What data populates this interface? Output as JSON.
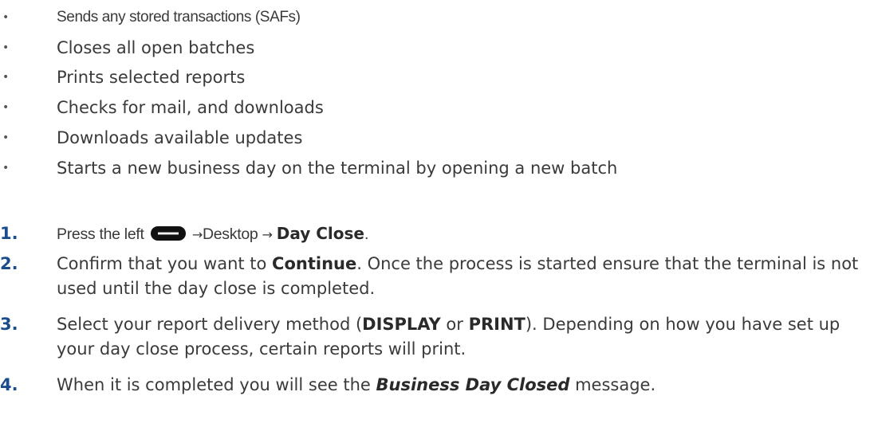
{
  "bullets": [
    {
      "text": "Sends any stored transactions (SAFs)"
    },
    {
      "text": "Closes all open batches"
    },
    {
      "text": "Prints selected reports"
    },
    {
      "text": "Checks for mail, and downloads"
    },
    {
      "text": "Downloads available updates"
    },
    {
      "text": "Starts a new business day on the terminal by opening a new batch"
    }
  ],
  "bullet_marker": "•",
  "arrow": "→",
  "steps": [
    {
      "number": "1.",
      "text_press_left": "Press the left",
      "text_desktop": "Desktop",
      "bold_day_close": "Day Close",
      "end": ".",
      "icon": "menu-key-icon"
    },
    {
      "number": "2.",
      "text_a": "Confirm that you want to ",
      "bold_continue": "Continue",
      "text_b": ". Once the process is started ensure that the terminal is not used until the day close is completed."
    },
    {
      "number": "3.",
      "text_a": "Select your report delivery method (",
      "bold_display": "DISPLAY",
      "text_or": " or ",
      "bold_print": "PRINT",
      "text_b": "). Depending on how you have set up your day close process, certain reports will print."
    },
    {
      "number": "4.",
      "text_a": "When it is completed you will see the ",
      "bold_italic_msg": "Business Day Closed",
      "text_b": " message."
    }
  ],
  "colors": {
    "step_number": "#1b4c8c",
    "text": "#3a3a3a",
    "icon": "#111111"
  }
}
